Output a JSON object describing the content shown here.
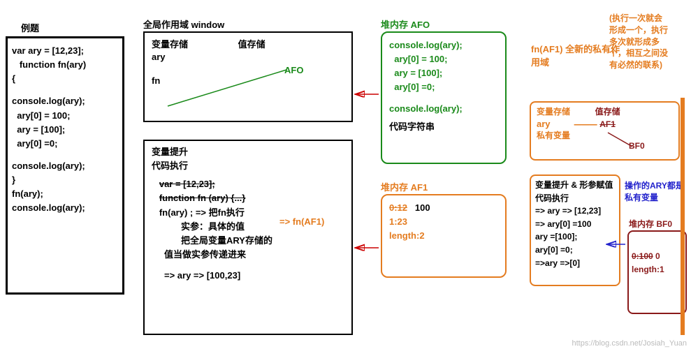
{
  "title_example": "例题",
  "code_panel": {
    "l1": "var ary = [12,23];",
    "l2": "   function fn(ary)",
    "l3": "{",
    "l4": "console.log(ary);",
    "l5": "  ary[0] = 100;",
    "l6": "  ary = [100];",
    "l7": "  ary[0] =0;",
    "l8": "console.log(ary);",
    "l9": "}",
    "l10": "fn(ary);",
    "l11": "console.log(ary);"
  },
  "global_scope_label": "全局作用域  window",
  "global_top": {
    "var_store": "变量存储",
    "val_store": "值存储",
    "ary": "ary",
    "fn": "fn",
    "afo": "AFO"
  },
  "global_bot": {
    "hoist": "变量提升",
    "exec": "代码执行",
    "l1": "var = [12,23];",
    "l2": "function fn (ary) {...}",
    "l3": "fn(ary) ; => 把fn执行",
    "l4": "实参：具体的值",
    "l5": "把全局变量ARY存储的",
    "l6": "值当做实参传递进来",
    "l7": "=> ary => [100,23]",
    "call": "=> fn(AF1)"
  },
  "heap0": {
    "title": "堆内存   AFO",
    "l1": "console.log(ary);",
    "l2": "  ary[0] = 100;",
    "l3": "  ary = [100];",
    "l4": "  ary[0] =0;",
    "l5": "console.log(ary);",
    "l6": "代码字符串"
  },
  "heap1": {
    "title": "堆内存   AF1",
    "l1a": "0:12",
    "l1b": "100",
    "l2": "1:23",
    "l3": "length:2"
  },
  "priv_scope_label": "fn(AF1) 全新的私有作用域",
  "note_multi": {
    "l1": "(执行一次就会",
    "l2": "形成一个，执行",
    "l3": "多次就形成多",
    "l4": "个，相互之间没",
    "l5": "有必然的联系)"
  },
  "priv_top": {
    "var_store": "变量存储",
    "val_store": "值存储",
    "ary": "ary",
    "af1": "AF1",
    "bf0": "BF0",
    "priv_var": "私有变量"
  },
  "priv_bot": {
    "l1": "变量提升 & 形参赋值",
    "l2": "代码执行",
    "l3": "=> ary  => [12,23]",
    "l4": "=> ary[0] =100",
    "l5": " ary =[100];",
    "l6": "ary[0] =0;",
    "l7": "=>ary =>[0]"
  },
  "note_op": {
    "l1": "操作的ARY都是",
    "l2": "私有变量"
  },
  "bf0": {
    "title": "堆内存  BF0",
    "l1a": "0:100",
    "l1b": "0",
    "l2": "length:1"
  },
  "watermark": "https://blog.csdn.net/Josiah_Yuan"
}
